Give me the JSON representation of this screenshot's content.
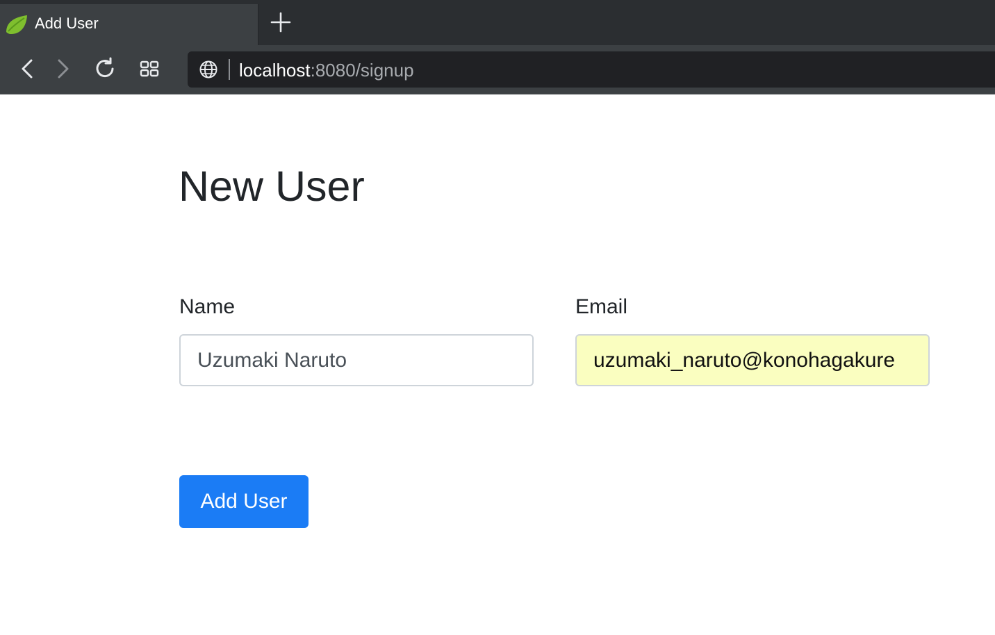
{
  "browser": {
    "tab": {
      "title": "Add User",
      "favicon": "spring-leaf-icon"
    },
    "toolbar": {
      "back_icon": "chevron-left-icon",
      "forward_icon": "chevron-right-icon",
      "reload_icon": "reload-icon",
      "tabs_icon": "grid-icon",
      "new_tab_icon": "plus-icon"
    },
    "address_bar": {
      "icon": "globe-icon",
      "host": "localhost",
      "rest": ":8080/signup"
    }
  },
  "page": {
    "title": "New User",
    "form": {
      "name_label": "Name",
      "name_value": "Uzumaki Naruto",
      "email_label": "Email",
      "email_value": "uzumaki_naruto@konohagakure",
      "submit_label": "Add User"
    }
  },
  "colors": {
    "chrome_dark": "#2b2e31",
    "toolbar": "#3c4043",
    "omnibox": "#202124",
    "primary_button": "#1b7cf5",
    "autofill_background": "#fafec0",
    "heading_text": "#212529"
  }
}
